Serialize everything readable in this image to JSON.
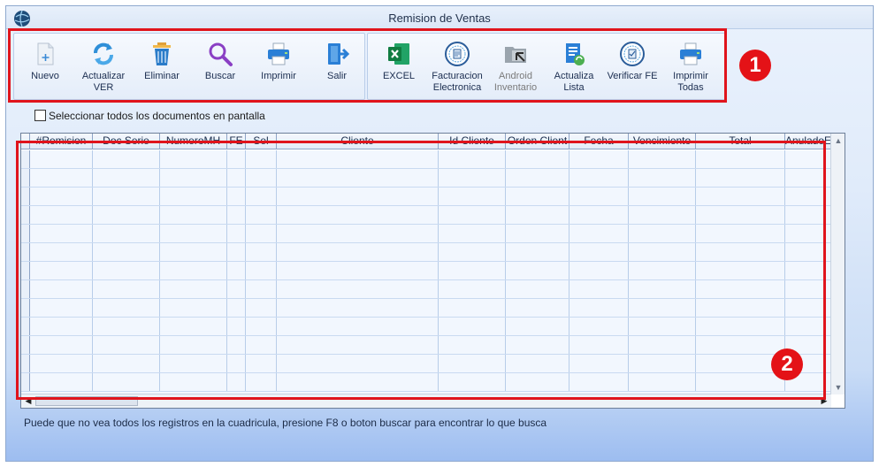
{
  "window": {
    "title": "Remision de Ventas"
  },
  "toolbar": {
    "group1": [
      {
        "label": "Nuevo",
        "icon": "new-document-icon"
      },
      {
        "label": "Actualizar\nVER",
        "icon": "refresh-icon"
      },
      {
        "label": "Eliminar",
        "icon": "trash-icon"
      },
      {
        "label": "Buscar",
        "icon": "search-icon"
      },
      {
        "label": "Imprimir",
        "icon": "printer-icon"
      },
      {
        "label": "Salir",
        "icon": "exit-icon"
      }
    ],
    "group2": [
      {
        "label": "EXCEL",
        "icon": "excel-icon"
      },
      {
        "label": "Facturacion\nElectronica",
        "icon": "e-invoice-seal-icon"
      },
      {
        "label": "Android\nInventario",
        "icon": "android-folder-icon",
        "disabled": true
      },
      {
        "label": "Actualiza\nLista",
        "icon": "update-list-icon"
      },
      {
        "label": "Verificar FE",
        "icon": "verify-seal-icon"
      },
      {
        "label": "Imprimir\nTodas",
        "icon": "print-all-icon"
      }
    ]
  },
  "select_all": {
    "label": "Seleccionar todos los documentos en pantalla",
    "checked": false
  },
  "grid": {
    "columns": [
      "#Remision",
      "Doc Serie",
      "NumeroMH",
      "FE",
      "Sel",
      "Cliente",
      "Id Cliente",
      "Orden Client",
      "Fecha",
      "Vencimiento",
      "Total",
      "AnuladoE"
    ],
    "rows": []
  },
  "status": {
    "message": "Puede que no vea todos los registros en la cuadricula, presione F8 o boton buscar para encontrar lo que busca"
  },
  "annotations": {
    "badge1": "1",
    "badge2": "2"
  },
  "colors": {
    "highlight": "#e0141c",
    "badge": "#e41217",
    "excel": "#1d6f42",
    "print": "#2a7fd6"
  }
}
